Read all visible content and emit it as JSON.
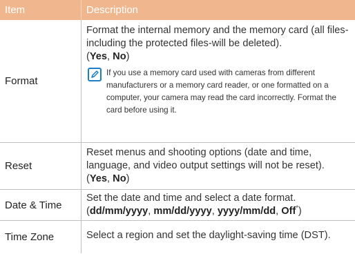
{
  "header": {
    "item": "Item",
    "description": "Description"
  },
  "rows": [
    {
      "item": "Format",
      "description": "Format the internal memory and the memory card (all files-including the protected files-will be deleted).",
      "options": [
        {
          "label": "Yes"
        },
        {
          "label": "No"
        }
      ],
      "note_icon": "pencil-note-icon",
      "note": "If you use a memory card used with cameras from different manufacturers or a memory card reader, or one formatted on a computer, your camera may read the card incorrectly. Format the card before using it."
    },
    {
      "item": "Reset",
      "description": "Reset menus and shooting options (date and time, language, and video output settings will not be reset).",
      "options": [
        {
          "label": "Yes"
        },
        {
          "label": "No"
        }
      ]
    },
    {
      "item": "Date & Time",
      "description": "Set the date and time and select a date format.",
      "options": [
        {
          "label": "dd/mm/yyyy"
        },
        {
          "label": "mm/dd/yyyy"
        },
        {
          "label": "yyyy/mm/dd"
        },
        {
          "label": "Off",
          "mark": "*"
        }
      ]
    },
    {
      "item": "Time Zone",
      "description": "Select a region and set the daylight-saving time (DST)."
    }
  ],
  "colors": {
    "header_bg": "#f0b78f",
    "note_icon": "#1c7fc3",
    "rule": "#bfbfbf"
  }
}
